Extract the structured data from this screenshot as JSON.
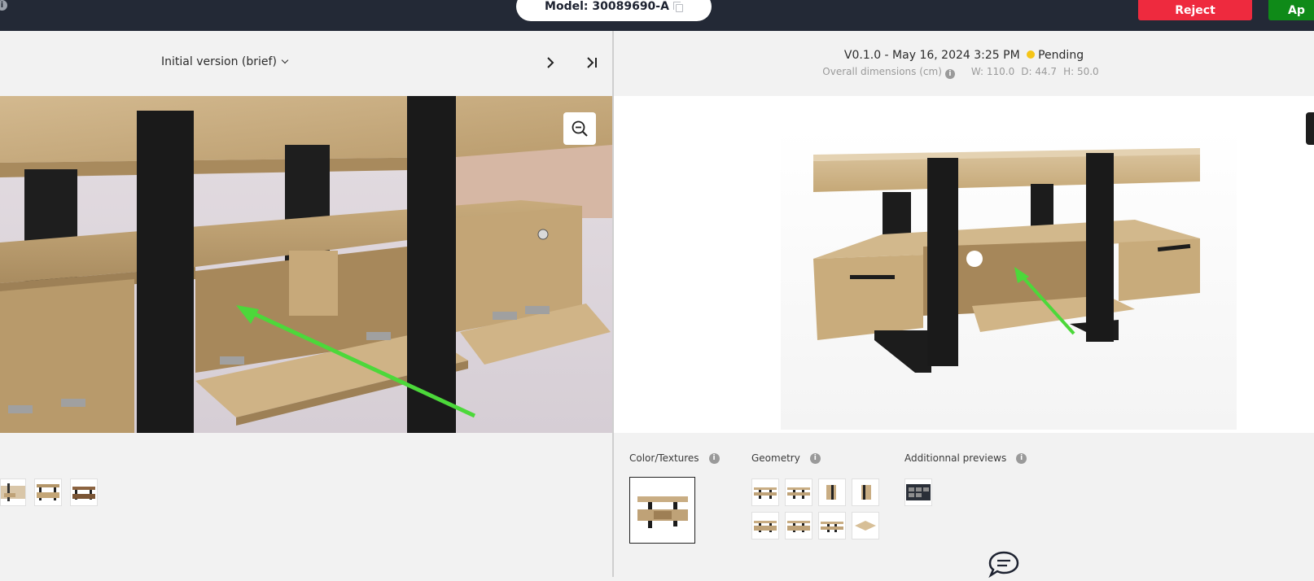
{
  "header": {
    "model_label": "Model: 30089690-A",
    "reject_label": "Reject",
    "approve_label": "Ap"
  },
  "left_panel": {
    "version_select": "Initial version (brief)"
  },
  "right_panel": {
    "version": "V0.1.0 - May 16, 2024 3:25 PM",
    "status": "Pending",
    "status_color": "#f5c518",
    "dimensions_label": "Overall dimensions (cm)",
    "width": "W: 110.0",
    "depth": "D: 44.7",
    "height": "H: 50.0"
  },
  "sections": {
    "color_textures": "Color/Textures",
    "geometry": "Geometry",
    "additional_previews": "Additionnal previews"
  },
  "colors": {
    "topbar": "#232936",
    "reject": "#ee2a3e",
    "approve": "#0f8a18",
    "arrow": "#4cd83a",
    "wood": "#c9ad83",
    "frame": "#1c1c1c"
  },
  "icons": [
    "info-icon",
    "copy-icon",
    "chevron-down-icon",
    "chevron-right-icon",
    "skip-last-icon",
    "zoom-out-icon",
    "chat-icon"
  ]
}
